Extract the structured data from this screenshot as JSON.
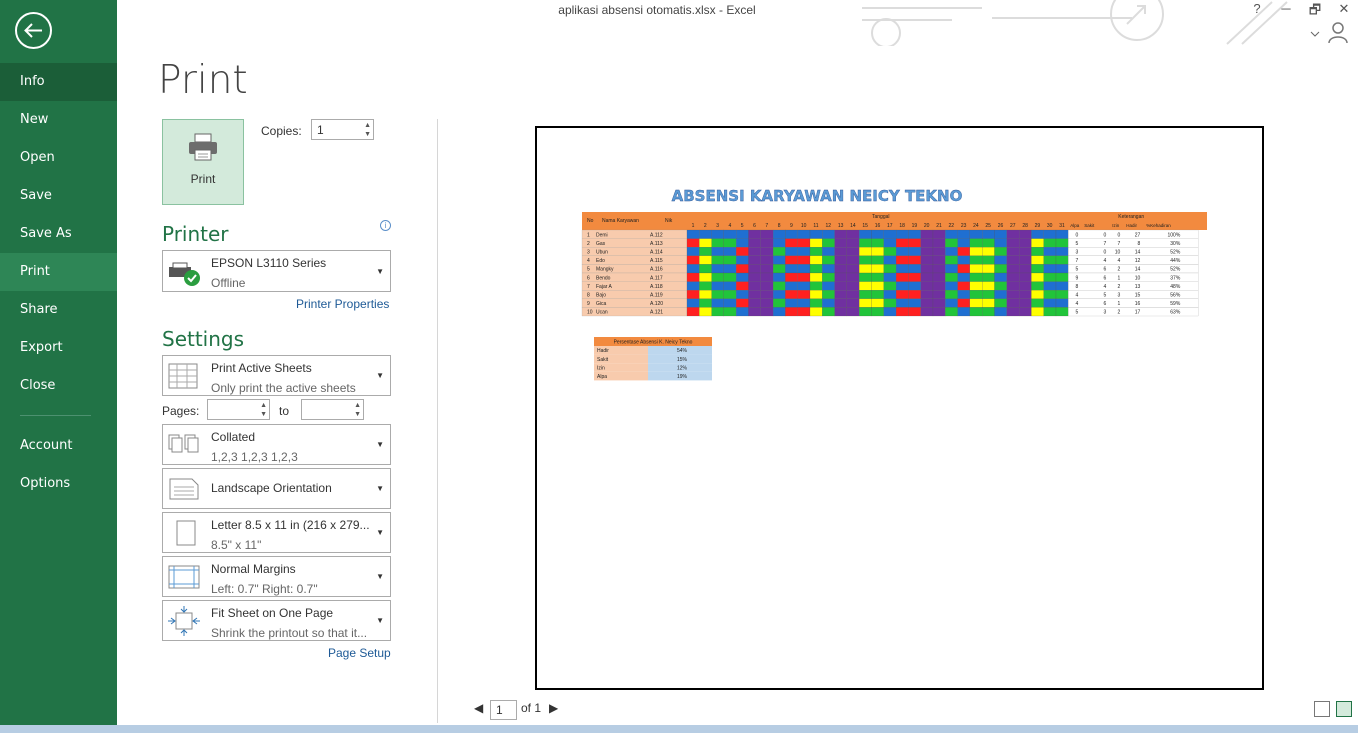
{
  "window": {
    "title": "aplikasi absensi otomatis.xlsx - Excel",
    "help": "?",
    "minimize": "─",
    "restore": "🗗",
    "close": "✕"
  },
  "nav": {
    "items": [
      {
        "label": "Info"
      },
      {
        "label": "New"
      },
      {
        "label": "Open"
      },
      {
        "label": "Save"
      },
      {
        "label": "Save As"
      },
      {
        "label": "Print"
      },
      {
        "label": "Share"
      },
      {
        "label": "Export"
      },
      {
        "label": "Close"
      },
      {
        "label": "Account"
      },
      {
        "label": "Options"
      }
    ],
    "active": "Print"
  },
  "print": {
    "title": "Print",
    "button_label": "Print",
    "copies_label": "Copies:",
    "copies_value": "1",
    "printer_heading": "Printer",
    "printer_name": "EPSON L3110 Series",
    "printer_status": "Offline",
    "printer_properties": "Printer Properties",
    "settings_heading": "Settings",
    "pages_label": "Pages:",
    "to_label": "to",
    "page_setup": "Page Setup",
    "settings": [
      {
        "title": "Print Active Sheets",
        "subtitle": "Only print the active sheets",
        "icon": "sheets-icon"
      },
      {
        "title": "Collated",
        "subtitle": "1,2,3    1,2,3    1,2,3",
        "icon": "collated-icon"
      },
      {
        "title": "Landscape Orientation",
        "subtitle": "",
        "icon": "landscape-icon"
      },
      {
        "title": "Letter 8.5 x 11 in (216 x 279...",
        "subtitle": "8.5\" x 11\"",
        "icon": "paper-size-icon"
      },
      {
        "title": "Normal Margins",
        "subtitle": "Left:  0.7\"    Right:  0.7\"",
        "icon": "margins-icon"
      },
      {
        "title": "Fit Sheet on One Page",
        "subtitle": "Shrink the printout so that it...",
        "icon": "fit-page-icon"
      }
    ]
  },
  "preview": {
    "heading": "ABSENSI KARYAWAN NEICY TEKNO",
    "header_no": "No",
    "header_name": "Nama Karyawan",
    "header_nik": "Nik",
    "header_tanggal": "Tanggal",
    "header_keterangan": "Keterangan",
    "days": [
      "1",
      "2",
      "3",
      "4",
      "5",
      "6",
      "7",
      "8",
      "9",
      "10",
      "11",
      "12",
      "13",
      "14",
      "15",
      "16",
      "17",
      "18",
      "19",
      "20",
      "21",
      "22",
      "23",
      "24",
      "25",
      "26",
      "27",
      "28",
      "29",
      "30",
      "31"
    ],
    "summary_headers": [
      "Alpa",
      "Sakit",
      "Izin",
      "Hadir",
      "%Kehadiran"
    ],
    "rows": [
      {
        "no": "1",
        "name": "Demi",
        "nik": "A.112",
        "alpa": "0",
        "sakit": "0",
        "izin": "0",
        "hadir": "27",
        "pct": "100%"
      },
      {
        "no": "2",
        "name": "Gas",
        "nik": "A.113",
        "alpa": "5",
        "sakit": "7",
        "izin": "7",
        "hadir": "8",
        "pct": "30%"
      },
      {
        "no": "3",
        "name": "Ubun",
        "nik": "A.114",
        "alpa": "3",
        "sakit": "0",
        "izin": "10",
        "hadir": "14",
        "pct": "52%"
      },
      {
        "no": "4",
        "name": "Edo",
        "nik": "A.115",
        "alpa": "7",
        "sakit": "4",
        "izin": "4",
        "hadir": "12",
        "pct": "44%"
      },
      {
        "no": "5",
        "name": "Mangky",
        "nik": "A.116",
        "alpa": "5",
        "sakit": "6",
        "izin": "2",
        "hadir": "14",
        "pct": "52%"
      },
      {
        "no": "6",
        "name": "Bendo",
        "nik": "A.117",
        "alpa": "9",
        "sakit": "6",
        "izin": "1",
        "hadir": "10",
        "pct": "37%"
      },
      {
        "no": "7",
        "name": "Fajar A",
        "nik": "A.118",
        "alpa": "8",
        "sakit": "4",
        "izin": "2",
        "hadir": "13",
        "pct": "48%"
      },
      {
        "no": "8",
        "name": "Bajo",
        "nik": "A.119",
        "alpa": "4",
        "sakit": "5",
        "izin": "3",
        "hadir": "15",
        "pct": "56%"
      },
      {
        "no": "9",
        "name": "Gica",
        "nik": "A.120",
        "alpa": "4",
        "sakit": "6",
        "izin": "1",
        "hadir": "16",
        "pct": "59%"
      },
      {
        "no": "10",
        "name": "Ucan",
        "nik": "A.121",
        "alpa": "5",
        "sakit": "3",
        "izin": "2",
        "hadir": "17",
        "pct": "63%"
      }
    ],
    "percent_title": "Persentase Absensi K. Neicy Tekno",
    "percent_rows": [
      {
        "label": "Hadir",
        "value": "54%"
      },
      {
        "label": "Sakit",
        "value": "15%"
      },
      {
        "label": "Izin",
        "value": "12%"
      },
      {
        "label": "Alpa",
        "value": "19%"
      }
    ]
  },
  "pager": {
    "current": "1",
    "of": "of 1"
  },
  "colors": {
    "accent": "#217346",
    "header": "#f28a3f",
    "name_fill": "#f8cbad",
    "blue": "#1f6fd1",
    "green": "#21c43a",
    "yellow": "#ffff00",
    "red": "#ff2020",
    "purple": "#7030a0"
  }
}
